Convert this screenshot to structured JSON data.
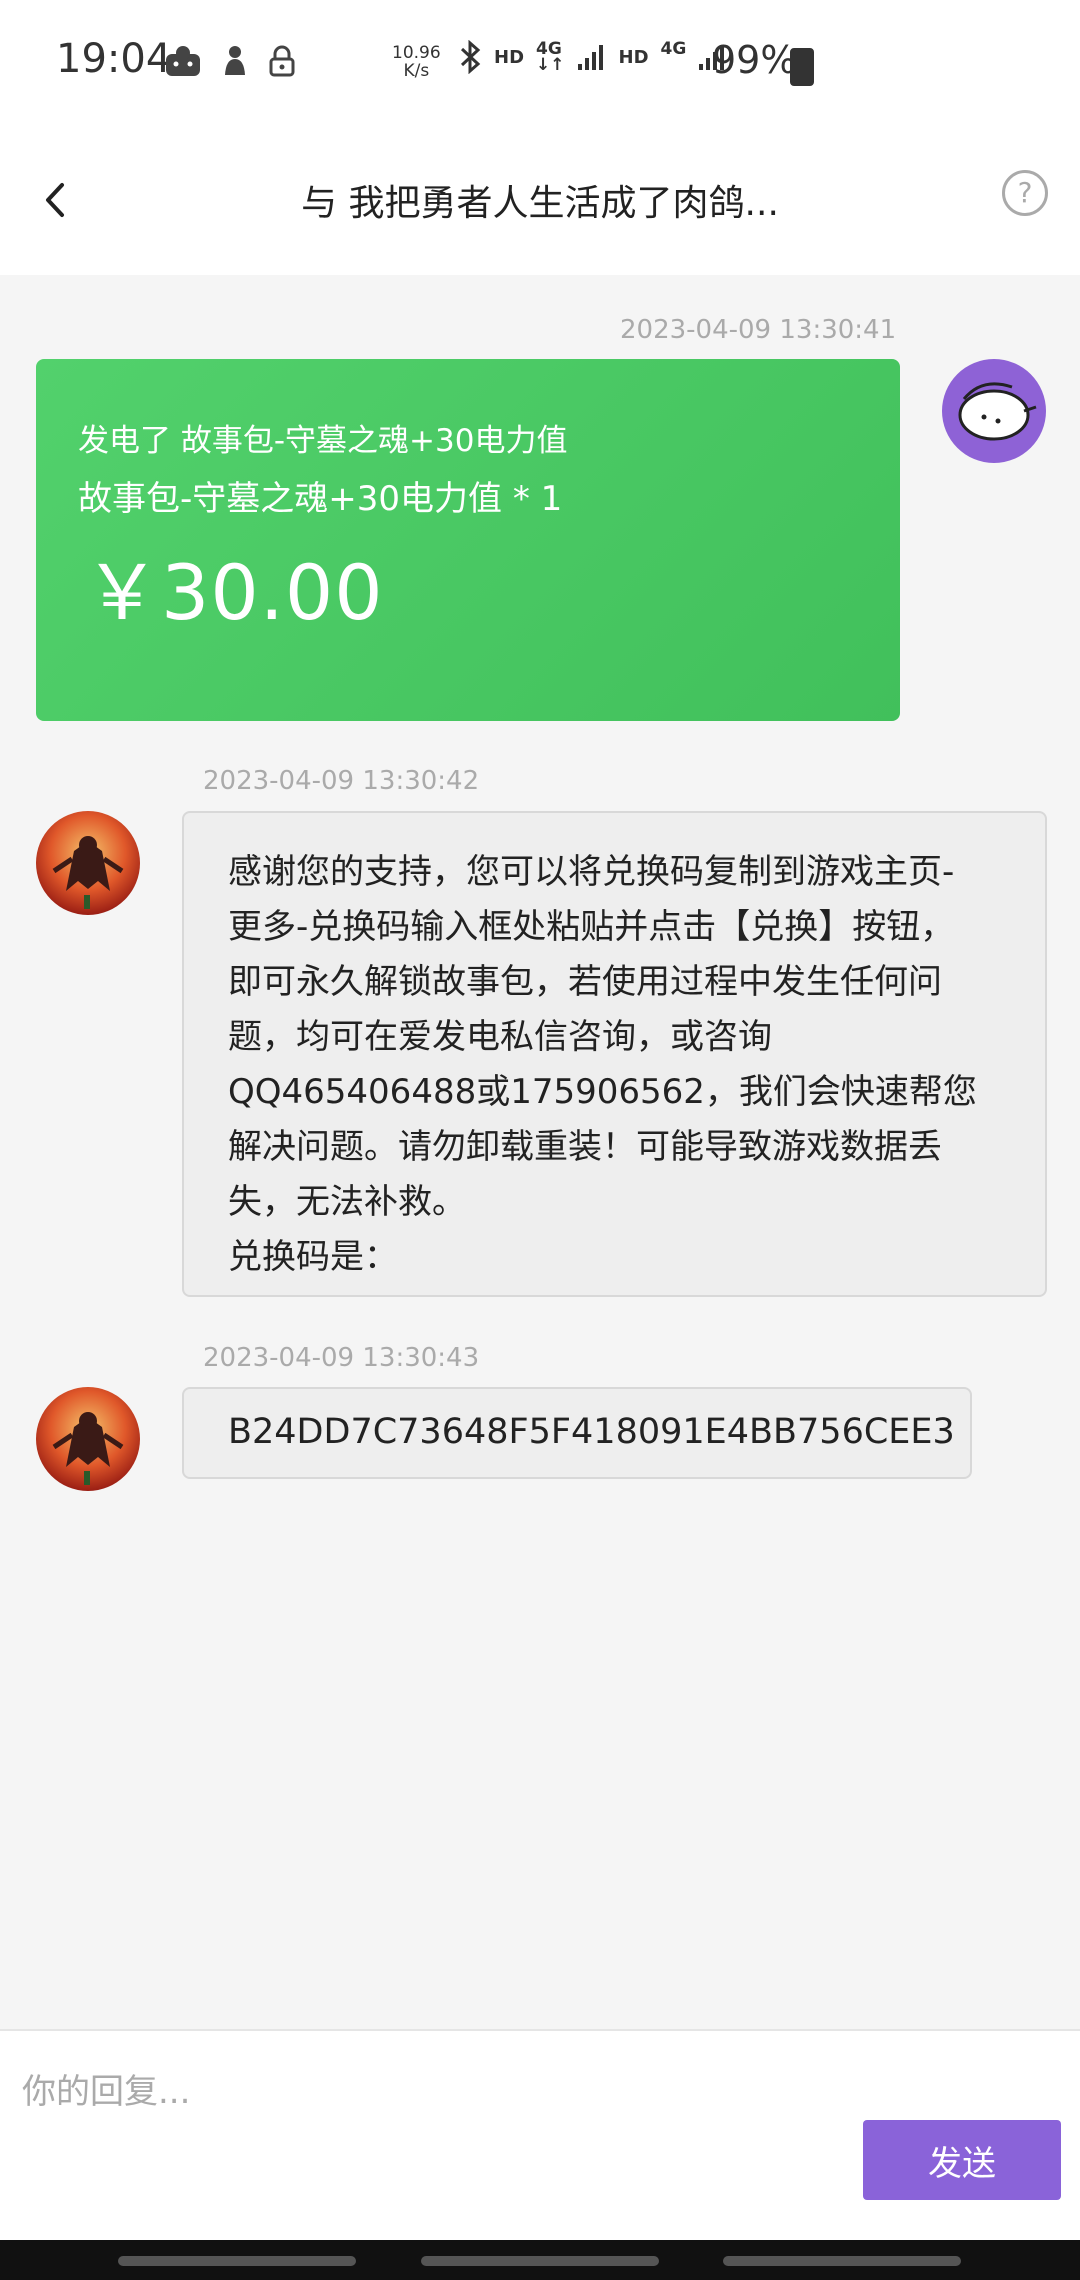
{
  "status_bar": {
    "time": "19:04",
    "net_speed_value": "10.96",
    "net_speed_unit": "K/s",
    "battery": "99%",
    "icons": [
      "game-icon",
      "figure-icon",
      "lock-icon",
      "bluetooth-icon",
      "hd-icon",
      "4g-icon",
      "signal-icon",
      "hd-icon",
      "4g-icon",
      "signal-icon",
      "battery-charging-icon"
    ]
  },
  "header": {
    "title": "与 我把勇者人生活成了肉鸽..."
  },
  "messages": [
    {
      "timestamp": "2023-04-09 13:30:41",
      "line1": "发电了 故事包-守墓之魂+30电力值",
      "line2": "故事包-守墓之魂+30电力值 * 1",
      "amount": "￥30.00"
    },
    {
      "timestamp": "2023-04-09 13:30:42",
      "lines": [
        "感谢您的支持，您可以将兑换码复制到游戏主页-",
        "更多-兑换码输入框处粘贴并点击【兑换】按钮，",
        "即可永久解锁故事包，若使用过程中发生任何问",
        "题，均可在爱发电私信咨询，或咨询",
        "QQ465406488或175906562，我们会快速帮您",
        "解决问题。请勿卸载重装！可能导致游戏数据丢",
        "失，无法补救。",
        "兑换码是："
      ]
    },
    {
      "timestamp": "2023-04-09 13:30:43",
      "text": "B24DD7C73648F5F418091E4BB756CEE3"
    }
  ],
  "composer": {
    "placeholder": "你的回复...",
    "send_label": "发送"
  },
  "colors": {
    "payment_bubble": "#4bcb65",
    "send_button": "#8a63d9",
    "self_avatar_bg": "#8e62d6"
  }
}
